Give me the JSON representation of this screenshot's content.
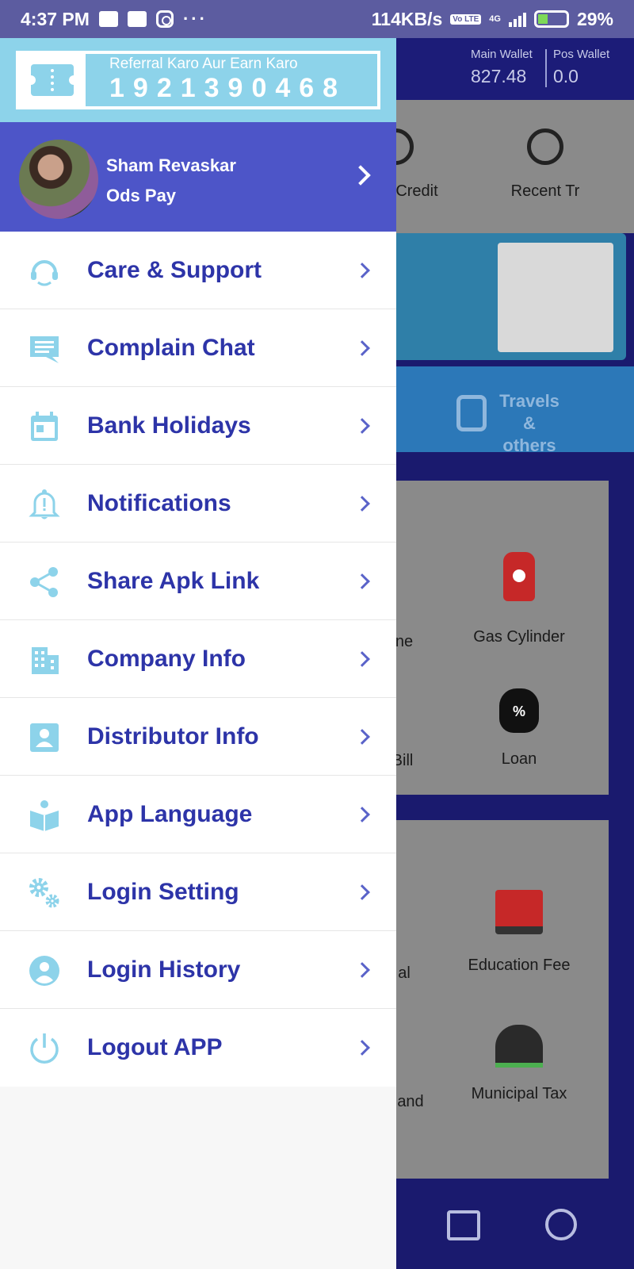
{
  "status_bar": {
    "time": "4:37 PM",
    "dots": "···",
    "speed": "114KB/s",
    "volte": "Vo LTE",
    "network": "4G",
    "battery": "29%"
  },
  "background": {
    "wallet": {
      "main_label": "Main Wallet",
      "main_value": "827.48",
      "pos_label": "Pos Wallet",
      "pos_value": "0.0"
    },
    "quick": [
      {
        "label": "Credit"
      },
      {
        "label": "Recent Tr"
      }
    ],
    "travel": "Travels & others",
    "services1": [
      "ne",
      "Gas Cylinder",
      "Bill",
      "Loan"
    ],
    "services2": [
      "al",
      "Education Fee",
      "and",
      "Municipal Tax"
    ]
  },
  "drawer": {
    "referral": {
      "title": "Referral Karo Aur Earn Karo",
      "code": "1921390468"
    },
    "profile": {
      "name": "Sham Revaskar",
      "company": "Ods Pay"
    },
    "menu": [
      {
        "label": "Care & Support",
        "icon": "support-icon"
      },
      {
        "label": "Complain Chat",
        "icon": "chat-icon"
      },
      {
        "label": "Bank Holidays",
        "icon": "calendar-icon"
      },
      {
        "label": "Notifications",
        "icon": "bell-icon"
      },
      {
        "label": "Share Apk Link",
        "icon": "share-icon"
      },
      {
        "label": "Company Info",
        "icon": "building-icon"
      },
      {
        "label": "Distributor Info",
        "icon": "contact-card-icon"
      },
      {
        "label": "App Language",
        "icon": "book-icon"
      },
      {
        "label": "Login Setting",
        "icon": "gears-icon"
      },
      {
        "label": "Login History",
        "icon": "user-circle-icon"
      },
      {
        "label": "Logout APP",
        "icon": "power-icon"
      }
    ]
  },
  "colors": {
    "drawer_header": "#4d55c8",
    "referral_bg": "#8dd3ea",
    "menu_text": "#2d34a8",
    "icon": "#8dd3ea",
    "background_app": "#1a1a6e"
  }
}
